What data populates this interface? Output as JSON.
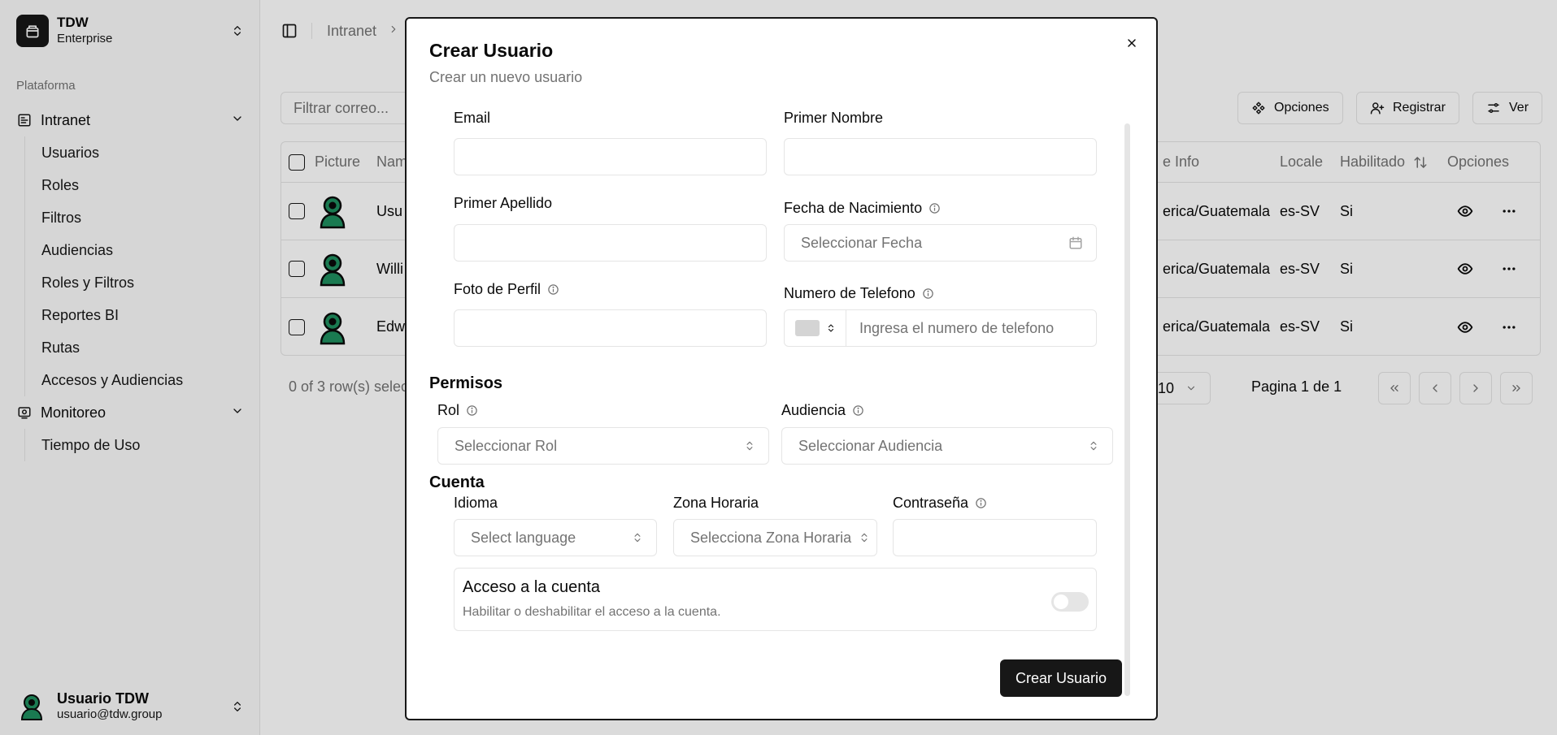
{
  "sidebar": {
    "team": {
      "name": "TDW",
      "plan": "Enterprise"
    },
    "group_label": "Plataforma",
    "sections": [
      {
        "label": "Intranet",
        "items": [
          "Usuarios",
          "Roles",
          "Filtros",
          "Audiencias",
          "Roles y Filtros",
          "Reportes BI",
          "Rutas",
          "Accesos y Audiencias"
        ]
      },
      {
        "label": "Monitoreo",
        "items": [
          "Tiempo de Uso"
        ]
      }
    ],
    "user": {
      "name": "Usuario TDW",
      "email": "usuario@tdw.group"
    }
  },
  "breadcrumb": {
    "root": "Intranet"
  },
  "toolbar": {
    "filter_placeholder": "Filtrar correo...",
    "options_label": "Opciones",
    "register_label": "Registrar",
    "view_label": "Ver"
  },
  "table": {
    "columns": [
      "Picture",
      "Nam",
      "e Info",
      "Locale",
      "Habilitado",
      "Opciones"
    ],
    "rows": [
      {
        "name": "Usu",
        "zone": "erica/Guatemala",
        "locale": "es-SV",
        "enabled": "Si"
      },
      {
        "name": "Willi",
        "zone": "erica/Guatemala",
        "locale": "es-SV",
        "enabled": "Si"
      },
      {
        "name": "Edw",
        "zone": "erica/Guatemala",
        "locale": "es-SV",
        "enabled": "Si"
      }
    ],
    "selection_text": "0 of 3 row(s) selec",
    "page_size": "10",
    "page_text": "Pagina 1 de 1"
  },
  "dialog": {
    "title": "Crear Usuario",
    "subtitle": "Crear un nuevo usuario",
    "email_label": "Email",
    "first_name_label": "Primer Nombre",
    "last_name_label": "Primer Apellido",
    "birth_label": "Fecha de Nacimiento",
    "birth_placeholder": "Seleccionar Fecha",
    "photo_label": "Foto de Perfil",
    "phone_label": "Numero de Telefono",
    "phone_placeholder": "Ingresa el numero de telefono",
    "permissions_title": "Permisos",
    "role_label": "Rol",
    "role_placeholder": "Seleccionar Rol",
    "audience_label": "Audiencia",
    "audience_placeholder": "Seleccionar Audiencia",
    "account_title": "Cuenta",
    "language_label": "Idioma",
    "language_placeholder": "Select language",
    "timezone_label": "Zona Horaria",
    "timezone_placeholder": "Selecciona Zona Horaria",
    "password_label": "Contraseña",
    "access_title": "Acceso a la cuenta",
    "access_desc": "Habilitar o deshabilitar el acceso a la cuenta.",
    "access_enabled": false,
    "submit_label": "Crear Usuario"
  }
}
